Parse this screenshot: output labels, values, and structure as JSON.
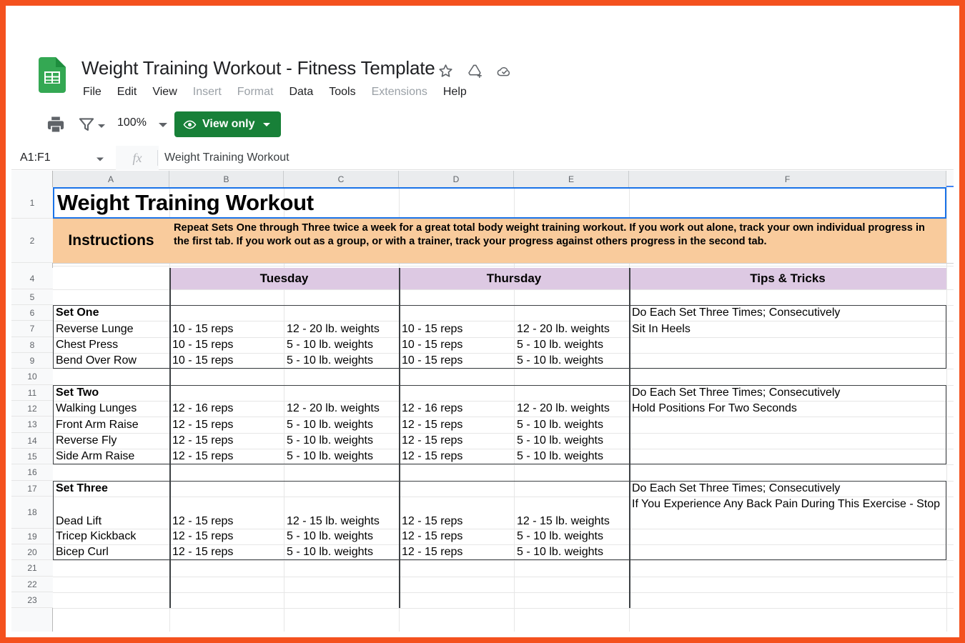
{
  "window": {
    "accent_border_color": "#f4511e"
  },
  "titlebar": {
    "doc_title": "Weight Training Workout - Fitness Template",
    "logo_name": "google-sheets-logo",
    "icons": [
      {
        "name": "star-icon",
        "label": "Star"
      },
      {
        "name": "move-to-drive-icon",
        "label": "Move to Drive"
      },
      {
        "name": "cloud-saved-icon",
        "label": "Saved to Drive"
      }
    ],
    "menu": [
      {
        "label": "File",
        "dim": false
      },
      {
        "label": "Edit",
        "dim": false
      },
      {
        "label": "View",
        "dim": false
      },
      {
        "label": "Insert",
        "dim": true
      },
      {
        "label": "Format",
        "dim": true
      },
      {
        "label": "Data",
        "dim": false
      },
      {
        "label": "Tools",
        "dim": false
      },
      {
        "label": "Extensions",
        "dim": true
      },
      {
        "label": "Help",
        "dim": false
      }
    ]
  },
  "toolbar": {
    "print_icon": "print-icon",
    "filter_icon": "filter-icon",
    "zoom_value": "100%",
    "view_mode_label": "View only",
    "view_mode_color": "#188038"
  },
  "formulabar": {
    "name_box": "A1:F1",
    "fx_label": "fx",
    "formula_value": "Weight Training Workout"
  },
  "grid": {
    "columns": [
      "A",
      "B",
      "C",
      "D",
      "E",
      "F"
    ],
    "rows": [
      "1",
      "2",
      "4",
      "5",
      "6",
      "7",
      "8",
      "9",
      "10",
      "11",
      "12",
      "13",
      "14",
      "15",
      "16",
      "17",
      "18",
      "19",
      "20",
      "21",
      "22",
      "23"
    ],
    "title_cell": "Weight Training Workout",
    "instructions_label": "Instructions",
    "instructions_text": "Repeat Sets One through Three twice a week for a great total body weight training workout.  If you work out alone, track your own individual progress in the first tab.  If you work out as a group, or with a trainer, track your progress against others progress in the second tab.",
    "instructions_bg": "#f9cb9c",
    "day_header_bg": "#ddc9e3",
    "day_headers": [
      {
        "label": "Tuesday"
      },
      {
        "label": "Thursday"
      },
      {
        "label": "Tips & Tricks"
      }
    ],
    "sets": [
      {
        "name": "Set One",
        "row": "6",
        "tips": [
          "Do Each Set Three Times; Consecutively",
          "Sit In Heels"
        ],
        "exercises": [
          {
            "row": "7",
            "name": "Reverse Lunge",
            "tue_reps": "10 - 15 reps",
            "tue_weight": "12 - 20 lb. weights",
            "thu_reps": "10 - 15 reps",
            "thu_weight": "12 - 20 lb. weights"
          },
          {
            "row": "8",
            "name": "Chest Press",
            "tue_reps": "10 - 15 reps",
            "tue_weight": "5 - 10 lb. weights",
            "thu_reps": "10 - 15 reps",
            "thu_weight": "5 - 10 lb. weights"
          },
          {
            "row": "9",
            "name": "Bend Over Row",
            "tue_reps": "10 - 15 reps",
            "tue_weight": "5 - 10 lb. weights",
            "thu_reps": "10 - 15 reps",
            "thu_weight": "5 - 10 lb. weights"
          }
        ]
      },
      {
        "name": "Set Two",
        "row": "11",
        "tips": [
          "Do Each Set Three Times; Consecutively",
          "Hold Positions For Two Seconds"
        ],
        "exercises": [
          {
            "row": "12",
            "name": "Walking Lunges",
            "tue_reps": "12 - 16 reps",
            "tue_weight": "12 - 20 lb. weights",
            "thu_reps": "12 - 16 reps",
            "thu_weight": "12 - 20 lb. weights"
          },
          {
            "row": "13",
            "name": "Front Arm Raise",
            "tue_reps": "12 - 15 reps",
            "tue_weight": "5 - 10 lb. weights",
            "thu_reps": "12 - 15 reps",
            "thu_weight": "5 - 10 lb. weights"
          },
          {
            "row": "14",
            "name": "Reverse Fly",
            "tue_reps": "12 - 15 reps",
            "tue_weight": "5 - 10 lb. weights",
            "thu_reps": "12 - 15 reps",
            "thu_weight": "5 - 10 lb. weights"
          },
          {
            "row": "15",
            "name": "Side Arm Raise",
            "tue_reps": "12 - 15 reps",
            "tue_weight": "5 - 10 lb. weights",
            "thu_reps": "12 - 15 reps",
            "thu_weight": "5 - 10 lb. weights"
          }
        ]
      },
      {
        "name": "Set Three",
        "row": "17",
        "tips": [
          "Do Each Set Three Times; Consecutively",
          "If You Experience Any Back Pain During This Exercise - Stop"
        ],
        "exercises": [
          {
            "row": "18",
            "name": "Dead Lift",
            "tue_reps": "12 - 15 reps",
            "tue_weight": "12 - 15 lb. weights",
            "thu_reps": "12 - 15 reps",
            "thu_weight": "12 - 15 lb. weights"
          },
          {
            "row": "19",
            "name": "Tricep Kickback",
            "tue_reps": "12 - 15 reps",
            "tue_weight": "5 - 10 lb. weights",
            "thu_reps": "12 - 15 reps",
            "thu_weight": "5 - 10 lb. weights"
          },
          {
            "row": "20",
            "name": "Bicep Curl",
            "tue_reps": "12 - 15 reps",
            "tue_weight": "5 - 10 lb. weights",
            "thu_reps": "12 - 15 reps",
            "thu_weight": "5 - 10 lb. weights"
          }
        ]
      }
    ]
  }
}
